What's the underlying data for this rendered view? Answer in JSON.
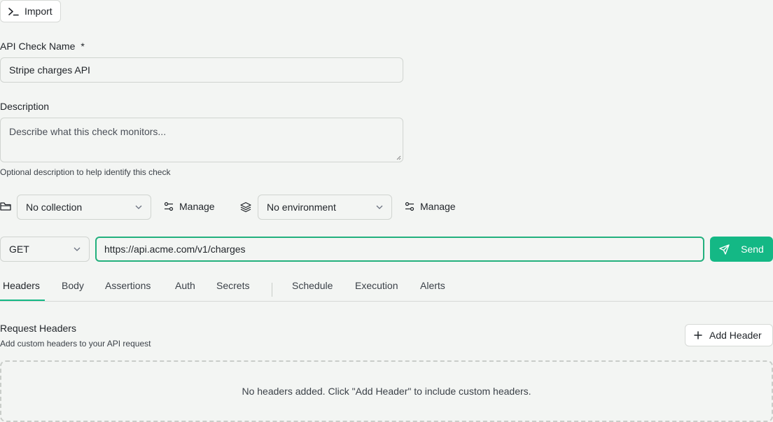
{
  "import_button": {
    "label": "Import",
    "icon": "terminal-icon"
  },
  "name_field": {
    "label": "API Check Name",
    "required_mark": "*",
    "value": "Stripe charges API"
  },
  "description_field": {
    "label": "Description",
    "placeholder": "Describe what this check monitors...",
    "help": "Optional description to help identify this check"
  },
  "collection": {
    "icon": "folder-icon",
    "value": "No collection",
    "manage_label": "Manage"
  },
  "environment": {
    "icon": "layers-icon",
    "value": "No environment",
    "manage_label": "Manage"
  },
  "request": {
    "method": "GET",
    "url": "https://api.acme.com/v1/charges",
    "send_label": "Send"
  },
  "tabs": [
    {
      "label": "Headers",
      "active": true
    },
    {
      "label": "Body"
    },
    {
      "label": "Assertions"
    },
    {
      "label": "Auth"
    },
    {
      "label": "Secrets"
    },
    {
      "label": "Schedule"
    },
    {
      "label": "Execution"
    },
    {
      "label": "Alerts"
    }
  ],
  "headers_section": {
    "title": "Request Headers",
    "subtitle": "Add custom headers to your API request",
    "add_label": "Add Header",
    "empty_text": "No headers added. Click \"Add Header\" to include custom headers."
  },
  "colors": {
    "accent": "#14b885",
    "focus_border": "#22b07d",
    "border": "#d0d4d0"
  }
}
